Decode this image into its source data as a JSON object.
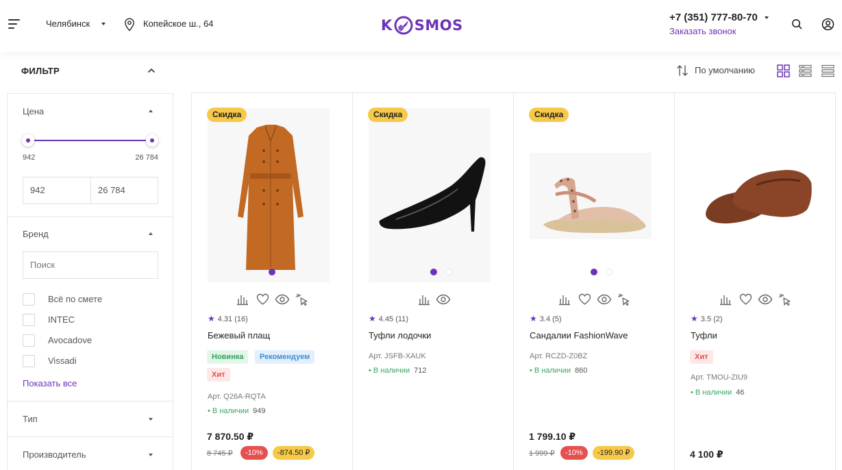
{
  "header": {
    "city": "Челябинск",
    "address": "Копейское ш., 64",
    "logo": "K SMOS",
    "phone": "+7 (351) 777-80-70",
    "callback": "Заказать звонок"
  },
  "filter": {
    "title": "ФИЛЬТР",
    "price": {
      "title": "Цена",
      "min": "942",
      "max": "26 784",
      "from": "942",
      "to": "26 784"
    },
    "brand": {
      "title": "Бренд",
      "search_placeholder": "Поиск",
      "options": [
        "Всё по смете",
        "INTEC",
        "Avocadove",
        "Vissadi"
      ],
      "show_all": "Показать все"
    },
    "type": {
      "title": "Тип"
    },
    "manufacturer": {
      "title": "Производитель"
    }
  },
  "sort": {
    "label": "По умолчанию"
  },
  "colors": {
    "accent": "#6b34b8",
    "discount": "#f7c948",
    "sale": "#e55050",
    "in_stock": "#3aa65e"
  },
  "products": [
    {
      "badge": "Скидка",
      "rating": "4.31 (16)",
      "name": "Бежевый плащ",
      "tags": [
        "Новинка",
        "Рекомендуем",
        "Хит"
      ],
      "article": "Арт. Q26A-RQTA",
      "stock": "В наличии",
      "qty": "949",
      "price": "7 870.50 ₽",
      "old_price": "8 745 ₽",
      "discount_pct": "-10%",
      "discount_sum": "-874.50 ₽"
    },
    {
      "badge": "Скидка",
      "rating": "4.45 (11)",
      "name": "Туфли лодочки",
      "article": "Арт. JSFB-XAUK",
      "stock": "В наличии",
      "qty": "712"
    },
    {
      "badge": "Скидка",
      "rating": "3.4 (5)",
      "name": "Сандалии FashionWave",
      "article": "Арт. RCZD-Z0BZ",
      "stock": "В наличии",
      "qty": "860",
      "price": "1 799.10 ₽",
      "old_price": "1 999 ₽",
      "discount_pct": "-10%",
      "discount_sum": "-199.90 ₽"
    },
    {
      "rating": "3.5 (2)",
      "name": "Туфли",
      "tags": [
        "Хит"
      ],
      "article": "Арт. TMOU-ZIU9",
      "stock": "В наличии",
      "qty": "46",
      "price": "4 100 ₽"
    }
  ]
}
